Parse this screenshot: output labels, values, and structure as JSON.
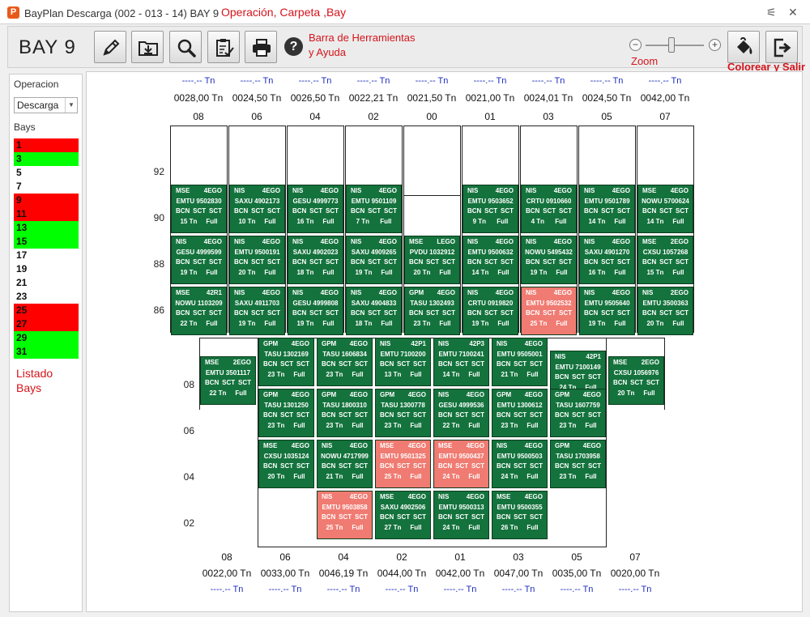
{
  "window": {
    "title": "BayPlan Descarga (002 - 013 - 14) BAY 9",
    "app_icon_letter": "P",
    "controls": [
      "⚟",
      "✕"
    ]
  },
  "annotations": {
    "title_note": "Operación, Carpeta ,Bay",
    "toolbar_note_1": "Barra de Herramientas",
    "toolbar_note_2": "y Ayuda",
    "zoom_note": "Zoom",
    "color_note": "Colorear y Salir",
    "list_note_1": "Listado",
    "list_note_2": "Bays"
  },
  "toolbar": {
    "bay_title": "BAY 9",
    "buttons": [
      {
        "name": "edit-button",
        "icon": "pencil-icon"
      },
      {
        "name": "download-folder-button",
        "icon": "folder-download-icon"
      },
      {
        "name": "search-button",
        "icon": "magnifier-icon"
      },
      {
        "name": "checklist-button",
        "icon": "clipboard-check-icon"
      },
      {
        "name": "print-button",
        "icon": "printer-icon"
      }
    ],
    "help_symbol": "?",
    "zoom_minus": "−",
    "zoom_plus": "+",
    "zoom_level": 0.45
  },
  "left_panel": {
    "operation_label": "Operacion",
    "operation_value": "Descarga",
    "bays_label": "Bays",
    "bays": [
      {
        "n": "1",
        "c": "#ff0000"
      },
      {
        "n": "3",
        "c": "#00ff00"
      },
      {
        "n": "5",
        "c": "#ffffff"
      },
      {
        "n": "7",
        "c": "#ffffff"
      },
      {
        "n": "9",
        "c": "#ff0000"
      },
      {
        "n": "11",
        "c": "#ff0000"
      },
      {
        "n": "13",
        "c": "#00ff00"
      },
      {
        "n": "15",
        "c": "#00ff00"
      },
      {
        "n": "17",
        "c": "#ffffff"
      },
      {
        "n": "19",
        "c": "#ffffff"
      },
      {
        "n": "21",
        "c": "#ffffff"
      },
      {
        "n": "23",
        "c": "#ffffff"
      },
      {
        "n": "25",
        "c": "#ff0000"
      },
      {
        "n": "27",
        "c": "#ff0000"
      },
      {
        "n": "29",
        "c": "#00ff00"
      },
      {
        "n": "31",
        "c": "#00ff00"
      }
    ]
  },
  "deck": {
    "columns": [
      {
        "label": "08",
        "dash": "----.-- Tn",
        "weight": "0028,00 Tn"
      },
      {
        "label": "06",
        "dash": "----.-- Tn",
        "weight": "0024,50 Tn"
      },
      {
        "label": "04",
        "dash": "----.-- Tn",
        "weight": "0026,50 Tn"
      },
      {
        "label": "02",
        "dash": "----.-- Tn",
        "weight": "0022,21 Tn"
      },
      {
        "label": "00",
        "dash": "----.-- Tn",
        "weight": "0021,50 Tn"
      },
      {
        "label": "01",
        "dash": "----.-- Tn",
        "weight": "0021,00 Tn"
      },
      {
        "label": "03",
        "dash": "----.-- Tn",
        "weight": "0024,01 Tn"
      },
      {
        "label": "05",
        "dash": "----.-- Tn",
        "weight": "0024,50 Tn"
      },
      {
        "label": "07",
        "dash": "----.-- Tn",
        "weight": "0042,00 Tn"
      }
    ],
    "rows": [
      "92",
      "90",
      "88",
      "86"
    ],
    "cells": [
      {
        "col": 0,
        "row": 1,
        "l1": [
          "MSE",
          "4EGO"
        ],
        "id": "EMTU 9502830",
        "p": [
          "BCN",
          "SCT",
          "SCT"
        ],
        "w": [
          "15 Tn",
          "Full"
        ],
        "color": "green"
      },
      {
        "col": 0,
        "row": 2,
        "l1": [
          "NIS",
          "4EGO"
        ],
        "id": "GESU 4999599",
        "p": [
          "BCN",
          "SCT",
          "SCT"
        ],
        "w": [
          "19 Tn",
          "Full"
        ],
        "color": "green"
      },
      {
        "col": 0,
        "row": 3,
        "l1": [
          "MSE",
          "42R1"
        ],
        "id": "NOWU 1103209",
        "p": [
          "BCN",
          "SCT",
          "SCT"
        ],
        "w": [
          "22 Tn",
          "Full"
        ],
        "color": "green"
      },
      {
        "col": 1,
        "row": 1,
        "l1": [
          "NIS",
          "4EGO"
        ],
        "id": "SAXU 4902173",
        "p": [
          "BCN",
          "SCT",
          "SCT"
        ],
        "w": [
          "10 Tn",
          "Full"
        ],
        "color": "green"
      },
      {
        "col": 1,
        "row": 2,
        "l1": [
          "NIS",
          "4EGO"
        ],
        "id": "EMTU 9500191",
        "p": [
          "BCN",
          "SCT",
          "SCT"
        ],
        "w": [
          "20 Tn",
          "Full"
        ],
        "color": "green"
      },
      {
        "col": 1,
        "row": 3,
        "l1": [
          "NIS",
          "4EGO"
        ],
        "id": "SAXU 4911703",
        "p": [
          "BCN",
          "SCT",
          "SCT"
        ],
        "w": [
          "19 Tn",
          "Full"
        ],
        "color": "green"
      },
      {
        "col": 2,
        "row": 1,
        "l1": [
          "NIS",
          "4EGO"
        ],
        "id": "GESU 4999773",
        "p": [
          "BCN",
          "SCT",
          "SCT"
        ],
        "w": [
          "16 Tn",
          "Full"
        ],
        "color": "green"
      },
      {
        "col": 2,
        "row": 2,
        "l1": [
          "NIS",
          "4EGO"
        ],
        "id": "SAXU 4902023",
        "p": [
          "BCN",
          "SCT",
          "SCT"
        ],
        "w": [
          "18 Tn",
          "Full"
        ],
        "color": "green"
      },
      {
        "col": 2,
        "row": 3,
        "l1": [
          "NIS",
          "4EGO"
        ],
        "id": "GESU 4999808",
        "p": [
          "BCN",
          "SCT",
          "SCT"
        ],
        "w": [
          "19 Tn",
          "Full"
        ],
        "color": "green"
      },
      {
        "col": 3,
        "row": 1,
        "l1": [
          "NIS",
          "4EGO"
        ],
        "id": "EMTU 9501109",
        "p": [
          "BCN",
          "SCT",
          "SCT"
        ],
        "w": [
          "7 Tn",
          "Full"
        ],
        "color": "green"
      },
      {
        "col": 3,
        "row": 2,
        "l1": [
          "NIS",
          "4EGO"
        ],
        "id": "SAXU 4909265",
        "p": [
          "BCN",
          "SCT",
          "SCT"
        ],
        "w": [
          "19 Tn",
          "Full"
        ],
        "color": "green"
      },
      {
        "col": 3,
        "row": 3,
        "l1": [
          "NIS",
          "4EGO"
        ],
        "id": "SAXU 4904833",
        "p": [
          "BCN",
          "SCT",
          "SCT"
        ],
        "w": [
          "18 Tn",
          "Full"
        ],
        "color": "green"
      },
      {
        "col": 4,
        "row": 2,
        "l1": [
          "MSE",
          "LEGO"
        ],
        "id": "PVDU 1032912",
        "p": [
          "BCN",
          "SCT",
          "SCT"
        ],
        "w": [
          "20 Tn",
          "Full"
        ],
        "color": "green"
      },
      {
        "col": 4,
        "row": 3,
        "l1": [
          "GPM",
          "4EGO"
        ],
        "id": "TASU 1302493",
        "p": [
          "BCN",
          "SCT",
          "SCT"
        ],
        "w": [
          "23 Tn",
          "Full"
        ],
        "color": "green"
      },
      {
        "col": 5,
        "row": 1,
        "l1": [
          "NIS",
          "4EGO"
        ],
        "id": "EMTU 9503652",
        "p": [
          "BCN",
          "SCT",
          "SCT"
        ],
        "w": [
          "9 Tn",
          "Full"
        ],
        "color": "green"
      },
      {
        "col": 5,
        "row": 2,
        "l1": [
          "NIS",
          "4EGO"
        ],
        "id": "EMTU 9500632",
        "p": [
          "BCN",
          "SCT",
          "SCT"
        ],
        "w": [
          "14 Tn",
          "Full"
        ],
        "color": "green"
      },
      {
        "col": 5,
        "row": 3,
        "l1": [
          "NIS",
          "4EGO"
        ],
        "id": "CRTU 0919820",
        "p": [
          "BCN",
          "SCT",
          "SCT"
        ],
        "w": [
          "19 Tn",
          "Full"
        ],
        "color": "green"
      },
      {
        "col": 6,
        "row": 1,
        "l1": [
          "NIS",
          "4EGO"
        ],
        "id": "CRTU 0910660",
        "p": [
          "BCN",
          "SCT",
          "SCT"
        ],
        "w": [
          "4 Tn",
          "Full"
        ],
        "color": "green"
      },
      {
        "col": 6,
        "row": 2,
        "l1": [
          "NIS",
          "4EGO"
        ],
        "id": "NOWU 5495432",
        "p": [
          "BCN",
          "SCT",
          "SCT"
        ],
        "w": [
          "19 Tn",
          "Full"
        ],
        "color": "green"
      },
      {
        "col": 6,
        "row": 3,
        "l1": [
          "NIS",
          "4EGO"
        ],
        "id": "EMTU 9502532",
        "p": [
          "BCN",
          "SCT",
          "SCT"
        ],
        "w": [
          "25 Tn",
          "Full"
        ],
        "color": "red"
      },
      {
        "col": 7,
        "row": 1,
        "l1": [
          "NIS",
          "4EGO"
        ],
        "id": "EMTU 9501789",
        "p": [
          "BCN",
          "SCT",
          "SCT"
        ],
        "w": [
          "14 Tn",
          "Full"
        ],
        "color": "green"
      },
      {
        "col": 7,
        "row": 2,
        "l1": [
          "NIS",
          "4EGO"
        ],
        "id": "SAXU 4901270",
        "p": [
          "BCN",
          "SCT",
          "SCT"
        ],
        "w": [
          "16 Tn",
          "Full"
        ],
        "color": "green"
      },
      {
        "col": 7,
        "row": 3,
        "l1": [
          "NIS",
          "4EGO"
        ],
        "id": "EMTU 9505640",
        "p": [
          "BCN",
          "SCT",
          "SCT"
        ],
        "w": [
          "19 Tn",
          "Full"
        ],
        "color": "green"
      },
      {
        "col": 8,
        "row": 1,
        "l1": [
          "MSE",
          "4EGO"
        ],
        "id": "NOWU 5700624",
        "p": [
          "BCN",
          "SCT",
          "SCT"
        ],
        "w": [
          "14 Tn",
          "Full"
        ],
        "color": "green"
      },
      {
        "col": 8,
        "row": 2,
        "l1": [
          "MSE",
          "2EGO"
        ],
        "id": "CXSU 1057268",
        "p": [
          "BCN",
          "SCT",
          "SCT"
        ],
        "w": [
          "15 Tn",
          "Full"
        ],
        "color": "green"
      },
      {
        "col": 8,
        "row": 3,
        "l1": [
          "NIS",
          "2EGO"
        ],
        "id": "EMTU 3500363",
        "p": [
          "BCN",
          "SCT",
          "SCT"
        ],
        "w": [
          "20 Tn",
          "Full"
        ],
        "color": "green"
      }
    ]
  },
  "hold": {
    "columns": [
      {
        "label": "08",
        "weight": "0022,00 Tn",
        "dash": "----.-- Tn"
      },
      {
        "label": "06",
        "weight": "0033,00 Tn",
        "dash": "----.-- Tn"
      },
      {
        "label": "04",
        "weight": "0046,19 Tn",
        "dash": "----.-- Tn"
      },
      {
        "label": "02",
        "weight": "0044,00 Tn",
        "dash": "----.-- Tn"
      },
      {
        "label": "01",
        "weight": "0042,00 Tn",
        "dash": "----.-- Tn"
      },
      {
        "label": "03",
        "weight": "0047,00 Tn",
        "dash": "----.-- Tn"
      },
      {
        "label": "05",
        "weight": "0035,00 Tn",
        "dash": "----.-- Tn"
      },
      {
        "label": "07",
        "weight": "0020,00 Tn",
        "dash": "----.-- Tn"
      }
    ],
    "rows": [
      "08",
      "06",
      "04",
      "02"
    ],
    "cells": [
      {
        "col": 0,
        "row": 0,
        "l1": [
          "MSE",
          "2EGO"
        ],
        "id": "EMTU 3501117",
        "p": [
          "BCN",
          "SCT",
          "SCT"
        ],
        "w": [
          "22 Tn",
          "Full"
        ],
        "color": "green"
      },
      {
        "col": 1,
        "row": 0,
        "l1": [
          "GPM",
          "4EGO"
        ],
        "id": "TASU 1302169",
        "p": [
          "BCN",
          "SCT",
          "SCT"
        ],
        "w": [
          "23 Tn",
          "Full"
        ],
        "color": "green"
      },
      {
        "col": 1,
        "row": 1,
        "l1": [
          "GPM",
          "4EGO"
        ],
        "id": "TASU 1301250",
        "p": [
          "BCN",
          "SCT",
          "SCT"
        ],
        "w": [
          "23 Tn",
          "Full"
        ],
        "color": "green"
      },
      {
        "col": 1,
        "row": 2,
        "l1": [
          "MSE",
          "4EGO"
        ],
        "id": "CXSU 1035124",
        "p": [
          "BCN",
          "SCT",
          "SCT"
        ],
        "w": [
          "20 Tn",
          "Full"
        ],
        "color": "green"
      },
      {
        "col": 2,
        "row": 0,
        "l1": [
          "GPM",
          "4EGO"
        ],
        "id": "TASU 1606834",
        "p": [
          "BCN",
          "SCT",
          "SCT"
        ],
        "w": [
          "23 Tn",
          "Full"
        ],
        "color": "green"
      },
      {
        "col": 2,
        "row": 1,
        "l1": [
          "GPM",
          "4EGO"
        ],
        "id": "TASU 1800310",
        "p": [
          "BCN",
          "SCT",
          "SCT"
        ],
        "w": [
          "23 Tn",
          "Full"
        ],
        "color": "green"
      },
      {
        "col": 2,
        "row": 2,
        "l1": [
          "NIS",
          "4EGO"
        ],
        "id": "NOWU 4717999",
        "p": [
          "BCN",
          "SCT",
          "SCT"
        ],
        "w": [
          "21 Tn",
          "Full"
        ],
        "color": "green"
      },
      {
        "col": 2,
        "row": 3,
        "l1": [
          "NIS",
          "4EGO"
        ],
        "id": "EMTU 9503858",
        "p": [
          "BCN",
          "SCT",
          "SCT"
        ],
        "w": [
          "25 Tn",
          "Full"
        ],
        "color": "red"
      },
      {
        "col": 3,
        "row": 0,
        "l1": [
          "NIS",
          "42P1"
        ],
        "id": "EMTU 7100200",
        "p": [
          "BCN",
          "SCT",
          "SCT"
        ],
        "w": [
          "13 Tn",
          "Full"
        ],
        "color": "green"
      },
      {
        "col": 3,
        "row": 1,
        "l1": [
          "GPM",
          "4EGO"
        ],
        "id": "TASU 1300778",
        "p": [
          "BCN",
          "SCT",
          "SCT"
        ],
        "w": [
          "23 Tn",
          "Full"
        ],
        "color": "green"
      },
      {
        "col": 3,
        "row": 2,
        "l1": [
          "MSE",
          "4EGO"
        ],
        "id": "EMTU 9501325",
        "p": [
          "BCN",
          "SCT",
          "SCT"
        ],
        "w": [
          "25 Tn",
          "Full"
        ],
        "color": "red"
      },
      {
        "col": 3,
        "row": 3,
        "l1": [
          "MSE",
          "4EGO"
        ],
        "id": "SAXU 4902506",
        "p": [
          "BCN",
          "SCT",
          "SCT"
        ],
        "w": [
          "27 Tn",
          "Full"
        ],
        "color": "green"
      },
      {
        "col": 4,
        "row": 0,
        "l1": [
          "NIS",
          "42P3"
        ],
        "id": "EMTU 7100241",
        "p": [
          "BCN",
          "SCT",
          "SCT"
        ],
        "w": [
          "14 Tn",
          "Full"
        ],
        "color": "green"
      },
      {
        "col": 4,
        "row": 1,
        "l1": [
          "NIS",
          "4EGO"
        ],
        "id": "GESU 4999536",
        "p": [
          "BCN",
          "SCT",
          "SCT"
        ],
        "w": [
          "22 Tn",
          "Full"
        ],
        "color": "green"
      },
      {
        "col": 4,
        "row": 2,
        "l1": [
          "MSE",
          "4EGO"
        ],
        "id": "EMTU 9500437",
        "p": [
          "BCN",
          "SCT",
          "SCT"
        ],
        "w": [
          "24 Tn",
          "Full"
        ],
        "color": "red"
      },
      {
        "col": 4,
        "row": 3,
        "l1": [
          "NIS",
          "4EGO"
        ],
        "id": "EMTU 9500313",
        "p": [
          "BCN",
          "SCT",
          "SCT"
        ],
        "w": [
          "24 Tn",
          "Full"
        ],
        "color": "green"
      },
      {
        "col": 5,
        "row": 0,
        "l1": [
          "NIS",
          "4EGO"
        ],
        "id": "EMTU 9505001",
        "p": [
          "BCN",
          "SCT",
          "SCT"
        ],
        "w": [
          "21 Tn",
          "Full"
        ],
        "color": "green"
      },
      {
        "col": 5,
        "row": 1,
        "l1": [
          "GPM",
          "4EGO"
        ],
        "id": "EMTU 1300612",
        "p": [
          "BCN",
          "SCT",
          "SCT"
        ],
        "w": [
          "23 Tn",
          "Full"
        ],
        "color": "green"
      },
      {
        "col": 5,
        "row": 2,
        "l1": [
          "NIS",
          "4EGO"
        ],
        "id": "EMTU 9500503",
        "p": [
          "BCN",
          "SCT",
          "SCT"
        ],
        "w": [
          "24 Tn",
          "Full"
        ],
        "color": "green"
      },
      {
        "col": 5,
        "row": 3,
        "l1": [
          "MSE",
          "4EGO"
        ],
        "id": "EMTU 9500355",
        "p": [
          "BCN",
          "SCT",
          "SCT"
        ],
        "w": [
          "26 Tn",
          "Full"
        ],
        "color": "green"
      },
      {
        "col": 6,
        "row": 0,
        "l1": [
          "NIS",
          "42P1"
        ],
        "id": "EMTU 7100149",
        "p": [
          "BCN",
          "SCT",
          "SCT"
        ],
        "w": [
          "24 Tn",
          "Full"
        ],
        "color": "green"
      },
      {
        "col": 6,
        "row": 1,
        "l1": [
          "GPM",
          "4EGO"
        ],
        "id": "TASU 1607759",
        "p": [
          "BCN",
          "SCT",
          "SCT"
        ],
        "w": [
          "23 Tn",
          "Full"
        ],
        "color": "green"
      },
      {
        "col": 6,
        "row": 2,
        "l1": [
          "GPM",
          "4EGO"
        ],
        "id": "TASU 1703958",
        "p": [
          "BCN",
          "SCT",
          "SCT"
        ],
        "w": [
          "23 Tn",
          "Full"
        ],
        "color": "green"
      },
      {
        "col": 7,
        "row": 0,
        "l1": [
          "MSE",
          "2EGO"
        ],
        "id": "CXSU 1056976",
        "p": [
          "BCN",
          "SCT",
          "SCT"
        ],
        "w": [
          "20 Tn",
          "Full"
        ],
        "color": "green"
      }
    ]
  }
}
